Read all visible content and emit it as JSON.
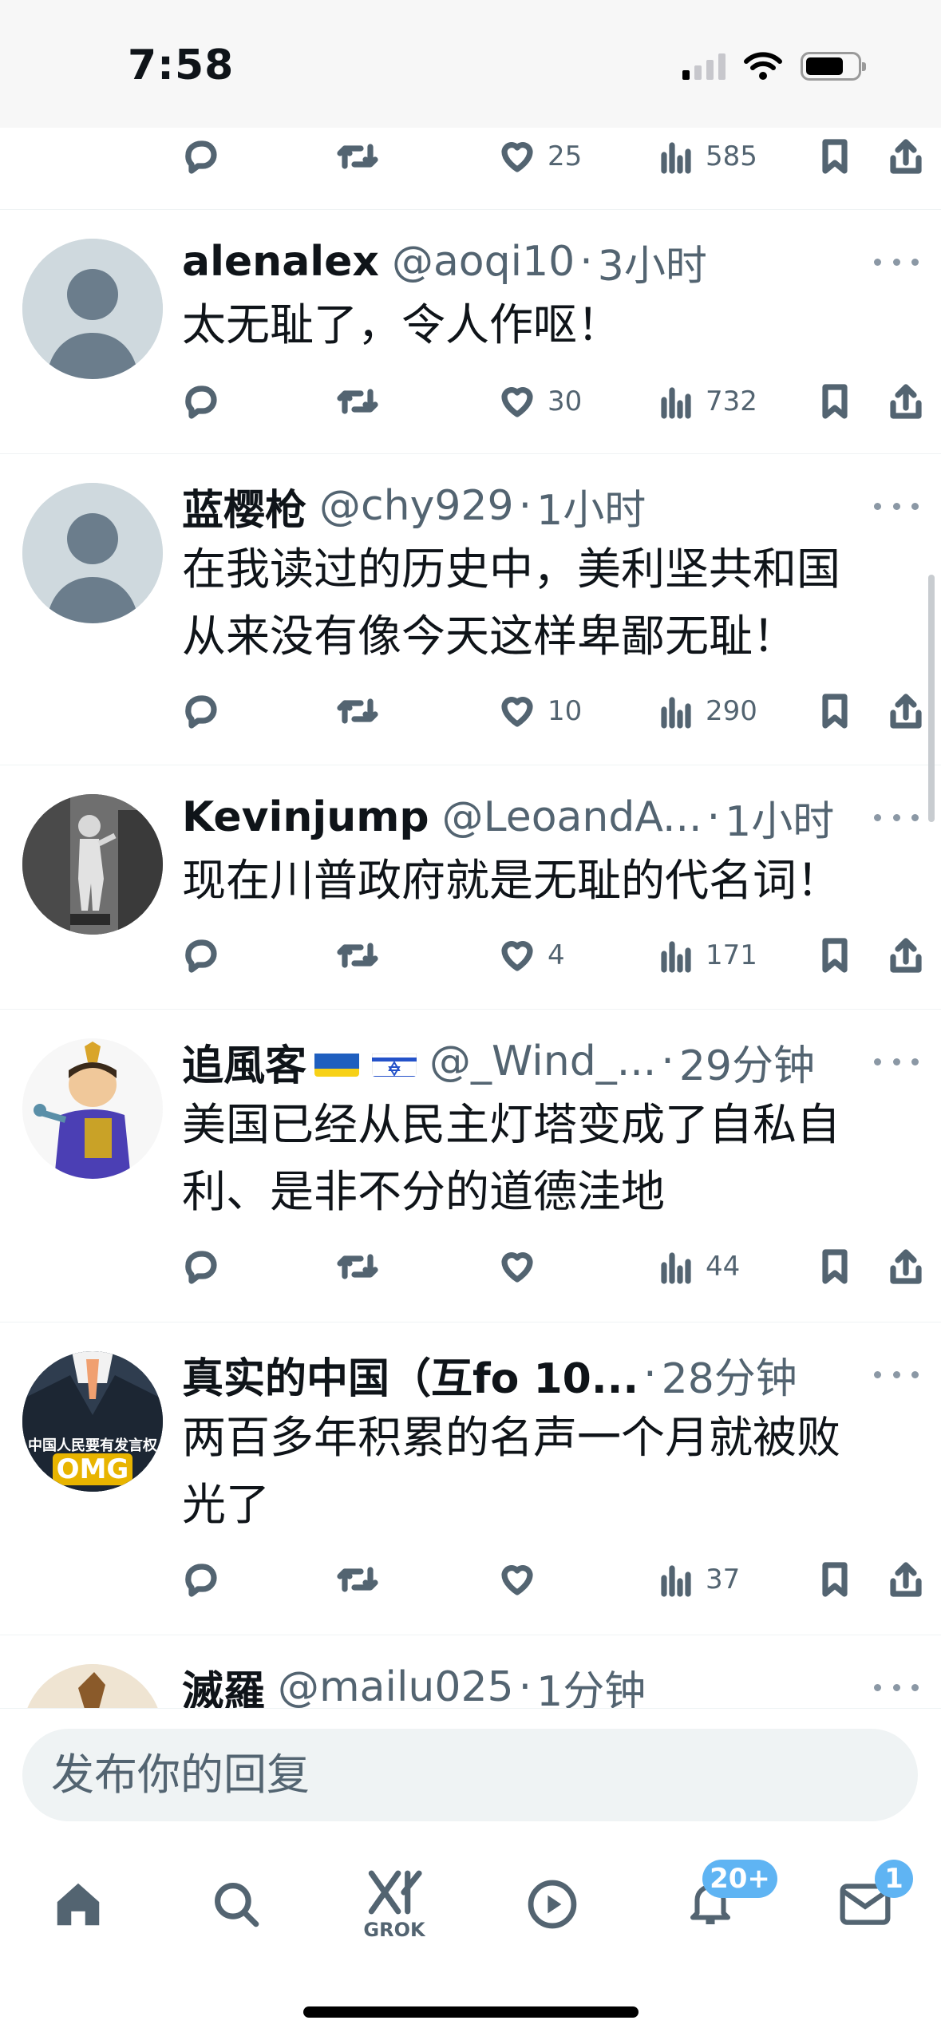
{
  "status": {
    "time": "7:58"
  },
  "partial_top": {
    "likes": "25",
    "views": "585"
  },
  "tweets": [
    {
      "name": "alenalex",
      "handle": "@aoqi10",
      "time": "3小时",
      "lines": [
        "太无耻了，令人作呕！"
      ],
      "likes": "30",
      "views": "732"
    },
    {
      "name": "蓝樱枪",
      "handle": "@chy929",
      "time": "1小时",
      "lines": [
        "在我读过的历史中，美利坚共和国",
        "从来没有像今天这样卑鄙无耻！"
      ],
      "likes": "10",
      "views": "290"
    },
    {
      "name": "Kevinjump",
      "handle": "@LeoandA...",
      "time": "1小时",
      "lines": [
        "现在川普政府就是无耻的代名词！"
      ],
      "likes": "4",
      "views": "171"
    },
    {
      "name": "追風客",
      "handle": "@_Wind_...",
      "time": "29分钟",
      "lines": [
        "美国已经从民主灯塔变成了自私自",
        "利、是非不分的道德洼地"
      ],
      "likes": "",
      "views": "44"
    },
    {
      "name": "真实的中国（互fo 10...",
      "handle": "",
      "time": "28分钟",
      "lines": [
        "两百多年积累的名声一个月就被败",
        "光了"
      ],
      "likes": "",
      "views": "37",
      "avatar_text": "中国人民要有发言权",
      "avatar_logo": "OMG"
    },
    {
      "name": "滅羅",
      "handle": "@mailu025",
      "time": "1分钟",
      "lines": []
    }
  ],
  "reply": {
    "placeholder": "发布你的回复"
  },
  "tabbar": {
    "items": [
      "home",
      "search",
      "grok",
      "video",
      "notifications",
      "messages"
    ],
    "grok_label": "GROK",
    "notifications_badge": "20+",
    "messages_badge": "1"
  },
  "colors": {
    "accent": "#1d9bf0",
    "badge": "#5fb4f3",
    "secondary_text": "#536471"
  }
}
